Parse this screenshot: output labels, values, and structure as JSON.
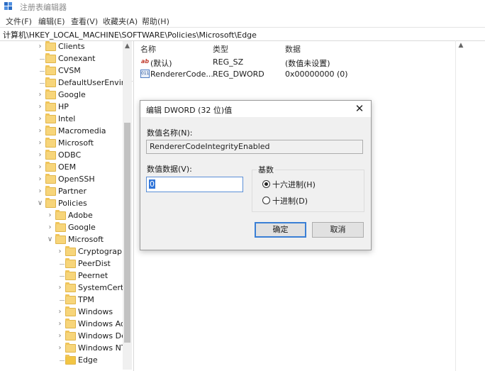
{
  "window": {
    "title": "注册表编辑器"
  },
  "menu": [
    "文件(F)",
    "编辑(E)",
    "查看(V)",
    "收藏夹(A)",
    "帮助(H)"
  ],
  "address": "计算机\\HKEY_LOCAL_MACHINE\\SOFTWARE\\Policies\\Microsoft\\Edge",
  "tree": {
    "items": [
      {
        "label": "Clients",
        "level": 0,
        "expander": "collapsed"
      },
      {
        "label": "Conexant",
        "level": 0,
        "expander": "none"
      },
      {
        "label": "CVSM",
        "level": 0,
        "expander": "none"
      },
      {
        "label": "DefaultUserEnviror",
        "level": 0,
        "expander": "none"
      },
      {
        "label": "Google",
        "level": 0,
        "expander": "collapsed"
      },
      {
        "label": "HP",
        "level": 0,
        "expander": "collapsed"
      },
      {
        "label": "Intel",
        "level": 0,
        "expander": "collapsed"
      },
      {
        "label": "Macromedia",
        "level": 0,
        "expander": "collapsed"
      },
      {
        "label": "Microsoft",
        "level": 0,
        "expander": "collapsed"
      },
      {
        "label": "ODBC",
        "level": 0,
        "expander": "collapsed"
      },
      {
        "label": "OEM",
        "level": 0,
        "expander": "collapsed"
      },
      {
        "label": "OpenSSH",
        "level": 0,
        "expander": "collapsed"
      },
      {
        "label": "Partner",
        "level": 0,
        "expander": "collapsed"
      },
      {
        "label": "Policies",
        "level": 0,
        "expander": "expanded"
      },
      {
        "label": "Adobe",
        "level": 1,
        "expander": "collapsed"
      },
      {
        "label": "Google",
        "level": 1,
        "expander": "collapsed"
      },
      {
        "label": "Microsoft",
        "level": 1,
        "expander": "expanded"
      },
      {
        "label": "Cryptography",
        "level": 2,
        "expander": "collapsed"
      },
      {
        "label": "PeerDist",
        "level": 2,
        "expander": "none"
      },
      {
        "label": "Peernet",
        "level": 2,
        "expander": "none"
      },
      {
        "label": "SystemCertifi",
        "level": 2,
        "expander": "collapsed"
      },
      {
        "label": "TPM",
        "level": 2,
        "expander": "none"
      },
      {
        "label": "Windows",
        "level": 2,
        "expander": "collapsed"
      },
      {
        "label": "Windows Adv",
        "level": 2,
        "expander": "collapsed"
      },
      {
        "label": "Windows Def",
        "level": 2,
        "expander": "collapsed"
      },
      {
        "label": "Windows NT",
        "level": 2,
        "expander": "collapsed"
      },
      {
        "label": "Edge",
        "level": 2,
        "expander": "none",
        "selected": true
      }
    ]
  },
  "list": {
    "headers": {
      "name": "名称",
      "type": "类型",
      "data": "数据"
    },
    "rows": [
      {
        "icon": "string-value-icon",
        "name": "(默认)",
        "type": "REG_SZ",
        "data": "(数值未设置)"
      },
      {
        "icon": "dword-value-icon",
        "name": "RendererCode...",
        "type": "REG_DWORD",
        "data": "0x00000000 (0)"
      }
    ]
  },
  "dialog": {
    "title": "编辑 DWORD (32 位)值",
    "name_label": "数值名称(N):",
    "name_value": "RendererCodeIntegrityEnabled",
    "data_label": "数值数据(V):",
    "data_value": "0",
    "base_label": "基数",
    "hex_label": "十六进制(H)",
    "dec_label": "十进制(D)",
    "selected_base": "hex",
    "ok_label": "确定",
    "cancel_label": "取消"
  }
}
